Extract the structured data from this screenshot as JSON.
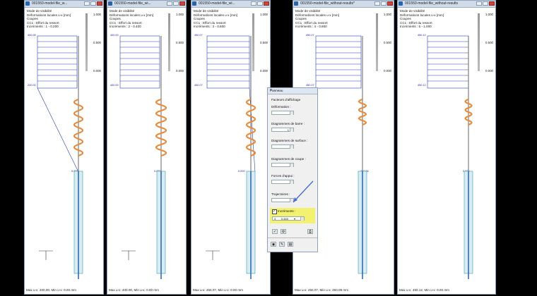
{
  "windows": [
    {
      "title": "001550-model-file_w...",
      "h1": "Mode de visibilité",
      "h2": "Déformations locales u-x [mm]",
      "h3": "Coupes",
      "h4": "CC1 : Effort du ressort",
      "h5": "Incréments : 1 - 0.200",
      "leg": [
        "1.000",
        "0.500",
        "0.000"
      ],
      "top_label": "400.00",
      "mid_label": "200.00",
      "low_label": "0.000",
      "footer": "Max u-x: 200.00, Min u-x: 0.00 mm"
    },
    {
      "title": "001550-model-file_wi...",
      "h1": "Mode de visibilité",
      "h2": "Déformations locales u-x [mm]",
      "h3": "Coupes",
      "h4": "CC1 : Effort du ressort",
      "h5": "Incréments : 2 - 0.400",
      "leg": [
        "1.000",
        "0.500",
        "0.000"
      ],
      "top_label": "400.00",
      "mid_label": "400.00",
      "low_label": "0.000",
      "footer": "Max u-x: 400.00, Min u-x: 0.00 mm"
    },
    {
      "title": "001550-model-file_wi...",
      "h1": "Mode de visibilité",
      "h2": "Déformations locales u-x [mm]",
      "h3": "Coupes",
      "h4": "CC1 : Effort du ressort",
      "h5": "Incréments : 3 - 0.600",
      "leg": [
        "1.000",
        "0.500",
        "0.000"
      ],
      "top_label": "450.07",
      "mid_label": "450.07",
      "low_label": "0.000",
      "footer": "Max u-x: 450.07, Min u-x: 0.00 mm"
    },
    {
      "title": "001550-model-file_without-results*",
      "h1": "Mode de visibilité",
      "h2": "Déformations locales u-x [mm]",
      "h3": "Coupes",
      "h4": "CC1 : Effort du ressort",
      "h5": "Incréments : 4 - 0.800",
      "leg": [
        "1.000",
        "0.500",
        "0.000"
      ],
      "top_label": "450.07",
      "mid_label": "450.07",
      "low_label": "450.06",
      "footer": "Max u-x: 450.07, Min u-x: 450.06 mm"
    },
    {
      "title": "001550-model-file_without-results",
      "h1": "Mode de visibilité",
      "h2": "Déformations locales u-x [mm]",
      "h3": "Coupes",
      "h4": "CC1 : Effort du ressort",
      "h5": "Incréments : 5 - 1.000",
      "leg": [
        "1.000",
        "0.500",
        "0.000"
      ],
      "top_label": "450.12",
      "mid_label": "450.12",
      "low_label": "0.000",
      "footer": "Max u-x: 450.12, Min u-x: 0.00 mm"
    }
  ],
  "panel": {
    "title": "Panneau",
    "close": "×",
    "facteurs": "Facteurs d'affichage",
    "deformation": "Déformation :",
    "diag_barre": "Diagrammes de barre :",
    "diag_barre_val": "1",
    "diag_surfaces": "Diagrammes de surface :",
    "diag_coupes": "Diagrammes de coupe :",
    "forces": "Forces d'appui :",
    "trajectoires": "Trajectoires :",
    "increments": "Incréments :",
    "inc_index": "3",
    "inc_value": "0.600"
  },
  "colors": {
    "accent": "#2b63a8",
    "spring": "#e38a3c",
    "mesh": "#2b3fa8",
    "highlight": "#f3f270"
  }
}
